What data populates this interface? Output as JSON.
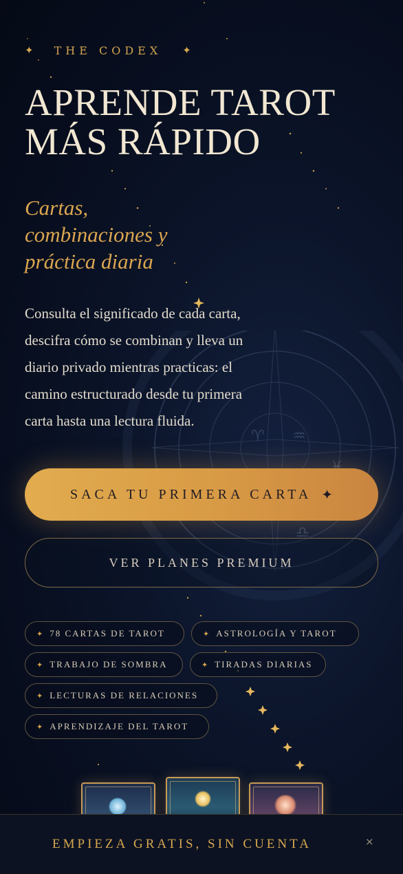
{
  "brand": {
    "name": "THE CODEX",
    "spark_icon": "sparkle-icon"
  },
  "hero": {
    "headline_line1": "APRENDE TAROT",
    "headline_line2": "MÁS RÁPIDO",
    "subheadline_line1": "Cartas,",
    "subheadline_line2": "combinaciones y",
    "subheadline_line3": "práctica diaria",
    "description_lines": [
      "Consulta el significado de cada carta,",
      "descifra cómo se combinan y lleva un",
      "diario privado mientras practicas: el",
      "camino estructurado desde tu primera",
      "carta hasta una lectura fluida."
    ]
  },
  "actions": {
    "primary_label": "SACA TU PRIMERA CARTA",
    "primary_icon": "sparkle-icon",
    "secondary_label": "VER PLANES PREMIUM"
  },
  "features": [
    "78 CARTAS DE TAROT",
    "ASTROLOGÍA Y TAROT",
    "TRABAJO DE SOMBRA",
    "TIRADAS DIARIAS",
    "LECTURAS DE RELACIONES",
    "APRENDIZAJE DEL TAROT"
  ],
  "bottom_bar": {
    "label": "EMPIEZA GRATIS, SIN CUENTA",
    "close_symbol": "×"
  },
  "colors": {
    "accent_gold": "#d8a84f",
    "background": "#070d1d",
    "cta_gradient_start": "#e2ac4f",
    "cta_gradient_end": "#c98540"
  }
}
